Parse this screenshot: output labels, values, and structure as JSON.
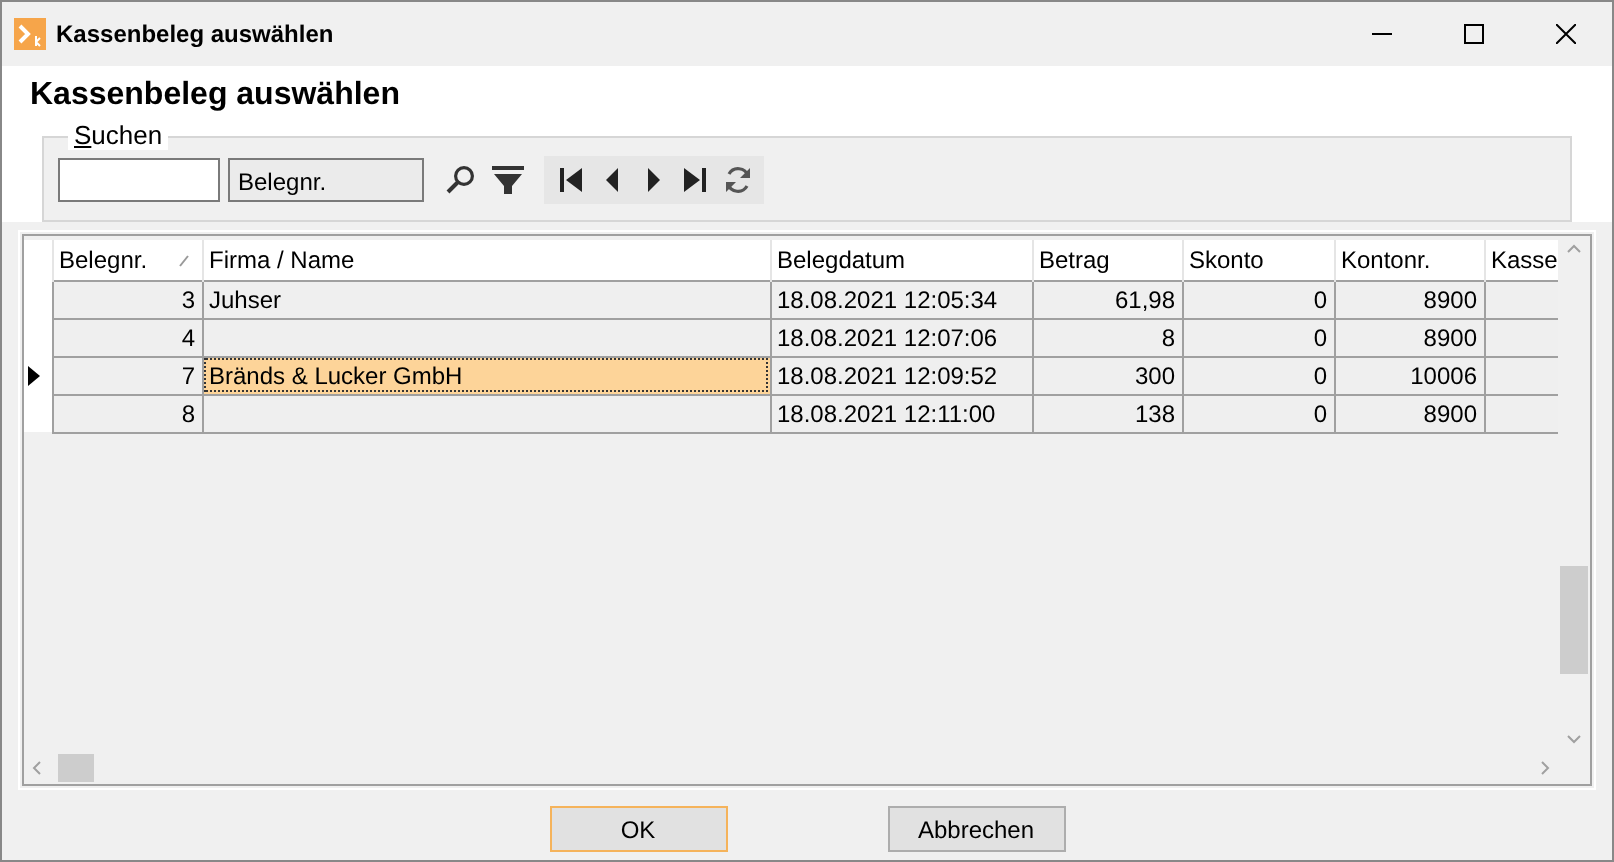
{
  "window": {
    "title": "Kassenbeleg auswählen"
  },
  "heading": "Kassenbeleg auswählen",
  "search": {
    "group_label": "Suchen",
    "field_choice": "Belegnr."
  },
  "table": {
    "columns": [
      {
        "label": "Belegnr.",
        "sorted": true
      },
      {
        "label": "Firma / Name",
        "sorted": false
      },
      {
        "label": "Belegdatum",
        "sorted": false
      },
      {
        "label": "Betrag",
        "sorted": false
      },
      {
        "label": "Skonto",
        "sorted": false
      },
      {
        "label": "Kontonr.",
        "sorted": false
      },
      {
        "label": "Kasse",
        "sorted": false
      }
    ],
    "rows": [
      {
        "selected": false,
        "cells": [
          "3",
          "Juhser",
          "18.08.2021 12:05:34",
          "61,98",
          "0",
          "8900",
          ""
        ]
      },
      {
        "selected": false,
        "cells": [
          "4",
          "",
          "18.08.2021 12:07:06",
          "8",
          "0",
          "8900",
          ""
        ]
      },
      {
        "selected": true,
        "cells": [
          "7",
          "Bränds & Lucker GmbH",
          "18.08.2021 12:09:52",
          "300",
          "0",
          "10006",
          ""
        ]
      },
      {
        "selected": false,
        "cells": [
          "8",
          "",
          "18.08.2021 12:11:00",
          "138",
          "0",
          "8900",
          ""
        ]
      }
    ]
  },
  "buttons": [
    {
      "label": "OK",
      "default": true
    },
    {
      "label": "Abbrechen",
      "default": false
    }
  ]
}
